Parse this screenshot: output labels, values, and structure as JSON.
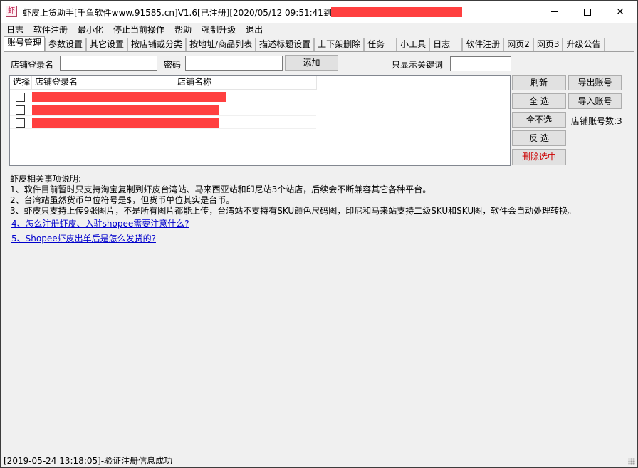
{
  "window": {
    "title": "虾皮上货助手[千鱼软件www.91585.cn]V1.6[已注册][2020/05/12 09:51:41到期]-",
    "icon_name": "app-icon",
    "minimize_icon": "minimize-icon",
    "maximize_icon": "maximize-icon",
    "close_icon": "close-icon"
  },
  "menu": [
    "日志",
    "软件注册",
    "最小化",
    "停止当前操作",
    "帮助",
    "强制升级",
    "退出"
  ],
  "tabs": [
    "账号管理",
    "参数设置",
    "其它设置",
    "按店铺或分类",
    "按地址/商品列表",
    "描述标题设置",
    "上下架删除",
    "任务",
    "小工具",
    "日志",
    "软件注册",
    "网页2",
    "网页3",
    "升级公告"
  ],
  "active_tab": "账号管理",
  "form": {
    "store_login_label": "店铺登录名",
    "store_login_value": "",
    "password_label": "密码",
    "password_value": "",
    "add_button": "添加",
    "keyword_label": "只显示关键词",
    "keyword_value": ""
  },
  "table": {
    "columns": [
      "选择",
      "店铺登录名",
      "店铺名称"
    ],
    "rows": [
      {
        "checked": false,
        "login": "",
        "name": ""
      },
      {
        "checked": false,
        "login": "",
        "name": ""
      },
      {
        "checked": false,
        "login": "",
        "name": ""
      }
    ]
  },
  "side_buttons": {
    "refresh": "刷新",
    "select_all": "全 选",
    "deselect_all": "全不选",
    "invert": "反 选",
    "delete_selected": "删除选中",
    "export": "导出账号",
    "import": "导入账号"
  },
  "store_count_label": "店铺账号数:3",
  "notes": {
    "heading": "虾皮相关事项说明:",
    "lines": [
      "1、软件目前暂时只支持淘宝复制到虾皮台湾站、马来西亚站和印尼站3个站店，后续会不断兼容其它各种平台。",
      "2、台湾站虽然货币单位符号是$，但货币单位其实是台币。",
      "3、虾皮只支持上传9张图片，不是所有图片都能上传，台湾站不支持有SKU颜色尺码图，印尼和马来站支持二级SKU和SKU图，软件会自动处理转换。"
    ],
    "link1": "4、怎么注册虾皮、入驻shopee需要注意什么?",
    "link2": "5、Shopee虾皮出单后是怎么发货的?"
  },
  "status": "[2019-05-24 13:18:05]-验证注册信息成功",
  "colors": {
    "redaction": "#ff4040",
    "delete_text": "#cc0000",
    "link": "#0000cc"
  }
}
